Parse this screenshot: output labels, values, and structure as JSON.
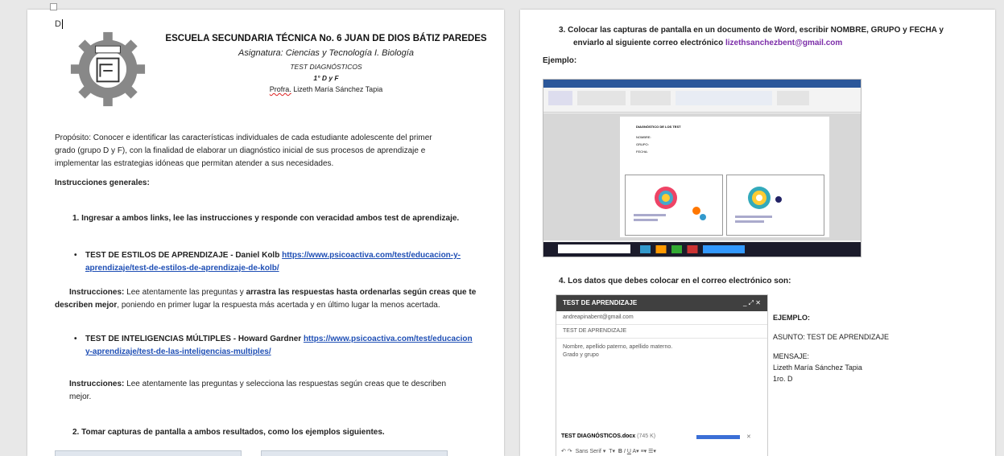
{
  "page1": {
    "cursor_char": "D",
    "school": "ESCUELA SECUNDARIA TÉCNICA No. 6 JUAN DE DIOS BÁTIZ PAREDES",
    "subject": "Asignatura: Ciencias y Tecnología I. Biología",
    "test_title": "TEST DIAGNÓSTICOS",
    "groups": "1° D y F",
    "teacher_prefix": "Profra.",
    "teacher_name": " Lizeth María Sánchez Tapia",
    "purpose_1": "Propósito: Conocer e identificar las características individuales de cada estudiante adolescente del primer",
    "purpose_2": "grado (grupo D y F), con la finalidad de elaborar un diagnóstico inicial de sus procesos de aprendizaje e",
    "purpose_3": "implementar las estrategias idóneas que permitan atender a sus necesidades.",
    "general_heading": "Instrucciones generales:",
    "step1": "1.   Ingresar a ambos links, lee las instrucciones y responde con veracidad ambos test de aprendizaje.",
    "bullet1_text": "TEST DE ESTILOS DE APRENDIZAJE - Daniel Kolb ",
    "bullet1_link_1": "https://www.psicoactiva.com/test/educacion-y-",
    "bullet1_link_2": "aprendizaje/test-de-estilos-de-aprendizaje-de-kolb/",
    "instr1_label": "Instrucciones:",
    "instr1_text_a": " Lee atentamente las preguntas y ",
    "instr1_bold_a": "arrastra las respuestas hasta ordenarlas según creas que te",
    "instr1_bold_b": "describen   mejor",
    "instr1_text_b": ", poniendo en primer lugar la respuesta más acertada y en último lugar la menos acertada.",
    "bullet2_text": "TEST DE INTELIGENCIAS MÚLTIPLES - Howard Gardner ",
    "bullet2_link_1": "https://www.psicoactiva.com/test/educacion",
    "bullet2_link_2": "y-aprendizaje/test-de-las-inteligencias-multiples/",
    "instr2_label": "Instrucciones:",
    "instr2_text_1": " Lee atentamente las preguntas y selecciona las respuestas según creas que te describen",
    "instr2_text_2": "mejor.",
    "step2": "2.   Tomar capturas de pantalla a ambos resultados, como los ejemplos siguientes."
  },
  "page2": {
    "step3_a": "3.   Colocar las capturas de pantalla en un documento de Word, escribir NOMBRE, GRUPO y FECHA y",
    "step3_b": "enviarlo al siguiente correo electrónico ",
    "email_link": "lizethsanchezbent@gmail.com",
    "example_label": "Ejemplo:",
    "word_doc_heading": "DIAGNÓSTICO DE LOS TEST",
    "word_nombre": "NOMBRE:",
    "word_grupo": "GRUPO:",
    "word_fecha": "FECHA:",
    "step4": "4.   Los datos que debes colocar en el correo electrónico son:",
    "mail_header": "TEST DE APRENDIZAJE",
    "mail_to": "andreapinabent@gmail.com",
    "mail_subject": "TEST DE APRENDIZAJE",
    "mail_body_1": "Nombre, apellido paterno, apellido materno.",
    "mail_body_2": "Grado y grupo",
    "attachment": "TEST DIAGNÓSTICOS.docx",
    "attachment_size": "(745 K)",
    "font_name": "Sans Serif",
    "ex_heading": "EJEMPLO:",
    "ex_asunto": "ASUNTO:  TEST DE APRENDIZAJE",
    "ex_mensaje": "MENSAJE:",
    "ex_name": "Lizeth María Sánchez Tapia",
    "ex_group": "1ro. D"
  },
  "colors": {
    "link": "#1f4fb5",
    "email": "#7b2ca8",
    "word_blue": "#2b579a",
    "mail_header": "#404040"
  }
}
